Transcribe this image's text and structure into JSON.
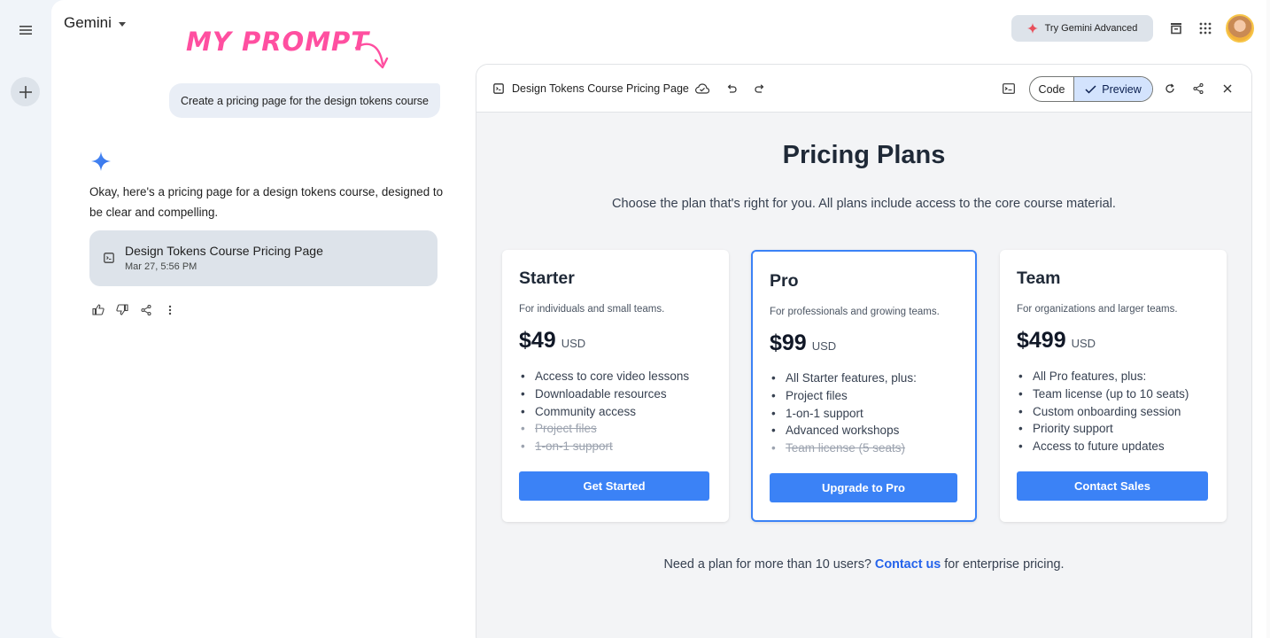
{
  "app": {
    "name": "Gemini",
    "try_advanced": "Try Gemini Advanced",
    "annotation": "MY PROMPT"
  },
  "chat": {
    "prompt": "Create a pricing page for the design tokens course",
    "answer": "Okay, here's a pricing page for a design tokens course, designed to be clear and compelling.",
    "artifact": {
      "title": "Design Tokens Course Pricing Page",
      "date": "Mar 27, 5:56 PM"
    }
  },
  "panel": {
    "title": "Design Tokens Course Pricing Page",
    "code_label": "Code",
    "preview_label": "Preview"
  },
  "pricing": {
    "title": "Pricing Plans",
    "subtitle": "Choose the plan that's right for you. All plans include access to the core course material.",
    "plans": [
      {
        "name": "Starter",
        "desc": "For individuals and small teams.",
        "price": "$49",
        "currency": "USD",
        "features": [
          {
            "text": "Access to core video lessons",
            "included": true
          },
          {
            "text": "Downloadable resources",
            "included": true
          },
          {
            "text": "Community access",
            "included": true
          },
          {
            "text": "Project files",
            "included": false
          },
          {
            "text": "1-on-1 support",
            "included": false
          }
        ],
        "button": "Get Started"
      },
      {
        "name": "Pro",
        "desc": "For professionals and growing teams.",
        "price": "$99",
        "currency": "USD",
        "features": [
          {
            "text": "All Starter features, plus:",
            "included": true
          },
          {
            "text": "Project files",
            "included": true
          },
          {
            "text": "1-on-1 support",
            "included": true
          },
          {
            "text": "Advanced workshops",
            "included": true
          },
          {
            "text": "Team license (5 seats)",
            "included": false
          }
        ],
        "button": "Upgrade to Pro"
      },
      {
        "name": "Team",
        "desc": "For organizations and larger teams.",
        "price": "$499",
        "currency": "USD",
        "features": [
          {
            "text": "All Pro features, plus:",
            "included": true
          },
          {
            "text": "Team license (up to 10 seats)",
            "included": true
          },
          {
            "text": "Custom onboarding session",
            "included": true
          },
          {
            "text": "Priority support",
            "included": true
          },
          {
            "text": "Access to future updates",
            "included": true
          }
        ],
        "button": "Contact Sales"
      }
    ],
    "footer_pre": "Need a plan for more than 10 users?",
    "footer_link": "Contact us",
    "footer_post": "for enterprise pricing."
  },
  "colors": {
    "accent": "#3b82f6",
    "annotation": "#ff4fa0",
    "preview_bg": "#d3e3fd"
  }
}
